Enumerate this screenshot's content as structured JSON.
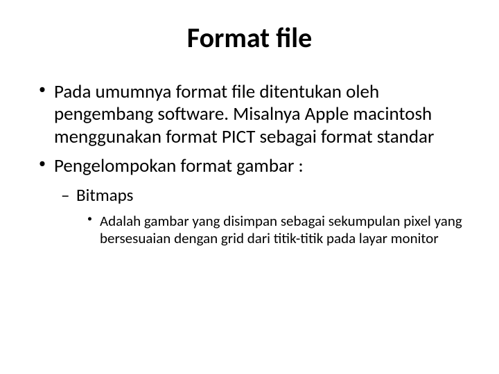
{
  "title": "Format file",
  "bullets": {
    "b1": "Pada umumnya format file ditentukan oleh pengembang software. Misalnya Apple macintosh menggunakan format PICT sebagai format standar",
    "b2": "Pengelompokan format gambar :",
    "b2_1": "Bitmaps",
    "b2_1_1": "Adalah gambar yang disimpan sebagai sekumpulan pixel yang bersesuaian dengan grid dari titik-titik pada layar monitor"
  }
}
